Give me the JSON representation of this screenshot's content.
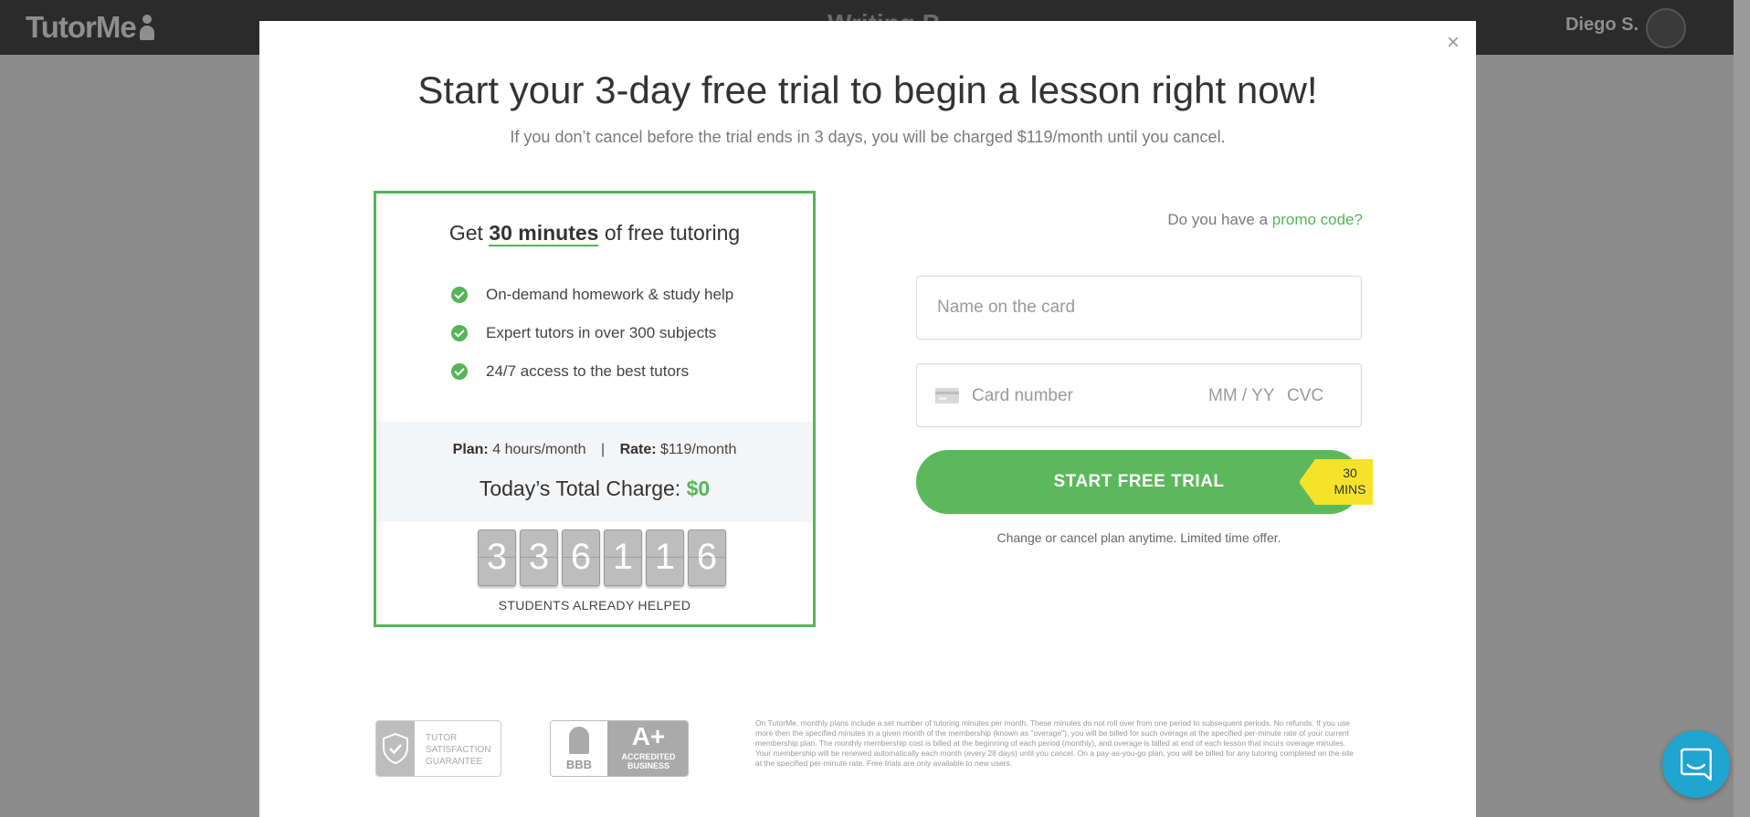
{
  "app": {
    "logo_text": "TutorMe",
    "page_title_partial": "Writing P",
    "user_name": "Diego S."
  },
  "modal": {
    "close_symbol": "×",
    "title": "Start your 3-day free trial to begin a lesson right now!",
    "subtitle": "If you don’t cancel before the trial ends in 3 days, you will be charged $119/month until you cancel."
  },
  "offer": {
    "head_prefix": "Get ",
    "head_highlight": "30 minutes",
    "head_suffix": " of free tutoring",
    "features": [
      "On-demand homework & study help",
      "Expert tutors in over 300 subjects",
      "24/7 access to the best tutors"
    ],
    "plan_label": "Plan:",
    "plan_value": "4 hours/month",
    "separator": "|",
    "rate_label": "Rate:",
    "rate_value": "$119/month",
    "charge_label": "Today’s Total Charge: ",
    "charge_value": "$0",
    "counter_digits": [
      "3",
      "3",
      "6",
      "1",
      "1",
      "6"
    ],
    "counter_label": "STUDENTS ALREADY HELPED"
  },
  "form": {
    "promo_prefix": "Do you have a ",
    "promo_link": "promo code?",
    "name_placeholder": "Name on the card",
    "card_placeholder": "Card number",
    "exp_placeholder": "MM / YY",
    "cvc_placeholder": "CVC",
    "submit_label": "START FREE TRIAL",
    "tag_top": "30",
    "tag_bottom": "MINS",
    "cancel_note": "Change or cancel plan anytime. Limited time offer."
  },
  "badges": {
    "guarantee_line1": "TUTOR",
    "guarantee_line2": "SATISFACTION",
    "guarantee_line3": "GUARANTEE",
    "bbb_logo": "BBB",
    "bbb_grade": "A+",
    "bbb_line1": "ACCREDITED",
    "bbb_line2": "BUSINESS"
  },
  "fineprint": "On TutorMe, monthly plans include a set number of tutoring minutes per month. These minutes do not roll over from one period to subsequent periods. No refunds. If you use more then the specified minutes in a given month of the membership (known as \"overage\"), you will be billed for such overage at the specified per-minute rate of your current membership plan. The monthly membership cost is billed at the beginning of each period (monthly), and overage is billed at end of each lesson that incurs overage minutes. Your membership will be renewed automatically each month (every 28 days) until you cancel. On a pay-as-you-go plan, you will be billed for any tutoring completed on the site at the specified per-minute rate. Free trials are only available to new users.",
  "colors": {
    "accent_green": "#55b559",
    "tag_yellow": "#f5e32a",
    "chat_blue": "#1fa5cf"
  },
  "icons": [
    "check-icon",
    "close-icon",
    "credit-card-icon",
    "shield-check-icon",
    "bbb-torch-icon",
    "chat-icon",
    "person-icon"
  ]
}
